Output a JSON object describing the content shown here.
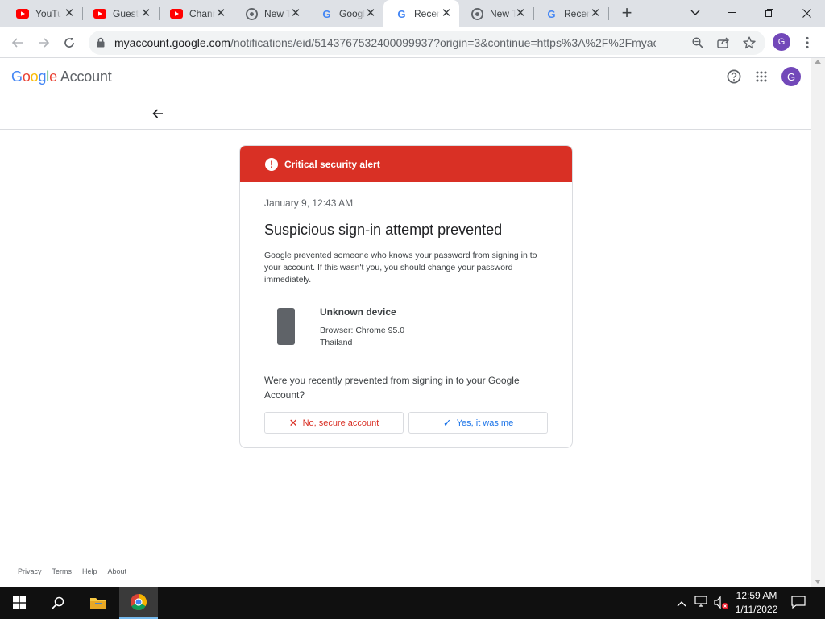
{
  "browser": {
    "tabs": [
      {
        "title": "YouTube",
        "icon": "youtube-icon"
      },
      {
        "title": "Guest",
        "icon": "youtube-icon"
      },
      {
        "title": "Channel",
        "icon": "youtube-icon"
      },
      {
        "title": "New Tab",
        "icon": "chrome-icon"
      },
      {
        "title": "Google",
        "icon": "google-icon"
      },
      {
        "title": "Recent",
        "icon": "google-icon",
        "active": true
      },
      {
        "title": "New Tab",
        "icon": "chrome-icon"
      },
      {
        "title": "Recent",
        "icon": "google-icon"
      }
    ],
    "url_host": "myaccount.google.com",
    "url_path": "/notifications/eid/5143767532400099937?origin=3&continue=https%3A%2F%2Fmyacco...",
    "profile_initial": "G"
  },
  "page": {
    "logo_google": "Google",
    "logo_account": "Account",
    "avatar_initial": "G",
    "alert_title": "Critical security alert",
    "date": "January 9, 12:43 AM",
    "headline": "Suspicious sign-in attempt prevented",
    "description": "Google prevented someone who knows your password from signing in to your account. If this wasn't you, you should change your password immediately.",
    "device_name": "Unknown device",
    "device_browser": "Browser: Chrome 95.0",
    "device_location": "Thailand",
    "question": "Were you recently prevented from signing in to your Google Account?",
    "no_button": "No, secure account",
    "yes_button": "Yes, it was me",
    "footer": {
      "privacy": "Privacy",
      "terms": "Terms",
      "help": "Help",
      "about": "About"
    }
  },
  "taskbar": {
    "time": "12:59 AM",
    "date": "1/11/2022"
  },
  "colors": {
    "alert_red": "#d93025",
    "link_blue": "#1a73e8",
    "avatar_purple": "#7248b9"
  }
}
